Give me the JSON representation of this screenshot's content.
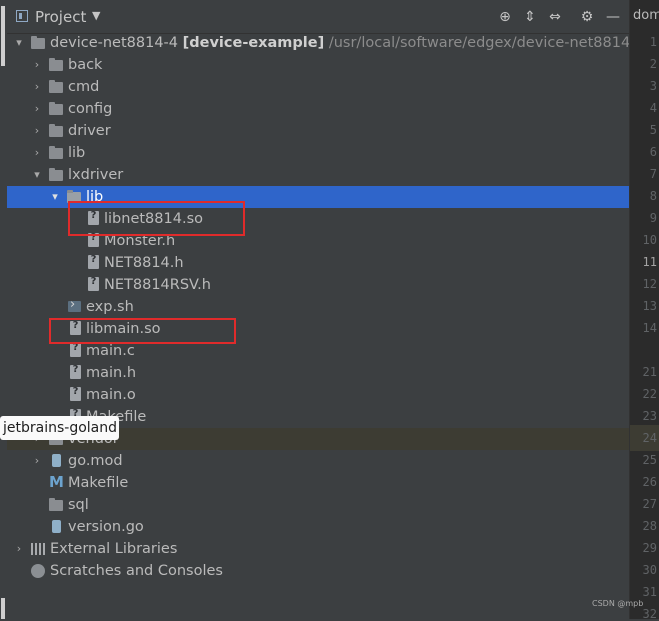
{
  "header": {
    "title": "Project",
    "dropdown_icon": "chevron-down-icon",
    "buttons": [
      "crosshair-icon",
      "expand-all-icon",
      "collapse-all-icon",
      "gear-icon",
      "minimize-icon"
    ]
  },
  "tree": {
    "root": {
      "name": "device-net8814-4",
      "module": "[device-example]",
      "path": "/usr/local/software/edgex/device-net8814-4"
    },
    "items": [
      {
        "label": "back",
        "type": "folder"
      },
      {
        "label": "cmd",
        "type": "folder"
      },
      {
        "label": "config",
        "type": "folder"
      },
      {
        "label": "driver",
        "type": "folder"
      },
      {
        "label": "lib",
        "type": "folder"
      },
      {
        "label": "lxdriver",
        "type": "folder-open"
      },
      {
        "label": "lib",
        "type": "folder-open",
        "selected": true
      },
      {
        "label": "libnet8814.so",
        "type": "unknown-file"
      },
      {
        "label": "Monster.h",
        "type": "unknown-file"
      },
      {
        "label": "NET8814.h",
        "type": "unknown-file"
      },
      {
        "label": "NET8814RSV.h",
        "type": "unknown-file"
      },
      {
        "label": "exp.sh",
        "type": "script"
      },
      {
        "label": "libmain.so",
        "type": "unknown-file"
      },
      {
        "label": "main.c",
        "type": "unknown-file"
      },
      {
        "label": "main.h",
        "type": "unknown-file"
      },
      {
        "label": "main.o",
        "type": "unknown-file"
      },
      {
        "label": "Makefile",
        "type": "unknown-file"
      },
      {
        "label": "vendor",
        "type": "folder"
      },
      {
        "label": "go.mod",
        "type": "gomod"
      },
      {
        "label": "Makefile",
        "type": "makefile"
      },
      {
        "label": "sql",
        "type": "folder"
      },
      {
        "label": "version.go",
        "type": "go"
      },
      {
        "label": "External Libraries",
        "type": "libraries"
      },
      {
        "label": "Scratches and Consoles",
        "type": "scratches"
      }
    ]
  },
  "tooltip": {
    "text": "jetbrains-goland"
  },
  "editor": {
    "tab_fragment": "dom",
    "line_numbers": [
      "1",
      "2",
      "3",
      "4",
      "5",
      "6",
      "7",
      "8",
      "9",
      "10",
      "11",
      "12",
      "13",
      "14",
      "21",
      "22",
      "23",
      "24",
      "25",
      "26",
      "27",
      "28",
      "29",
      "30",
      "31",
      "32"
    ],
    "current_line": "11"
  },
  "watermark": "CSDN @mpb",
  "colors": {
    "selection": "#2f65ca",
    "highlight_box": "#e02b2b",
    "panel_bg": "#3c3f41"
  }
}
